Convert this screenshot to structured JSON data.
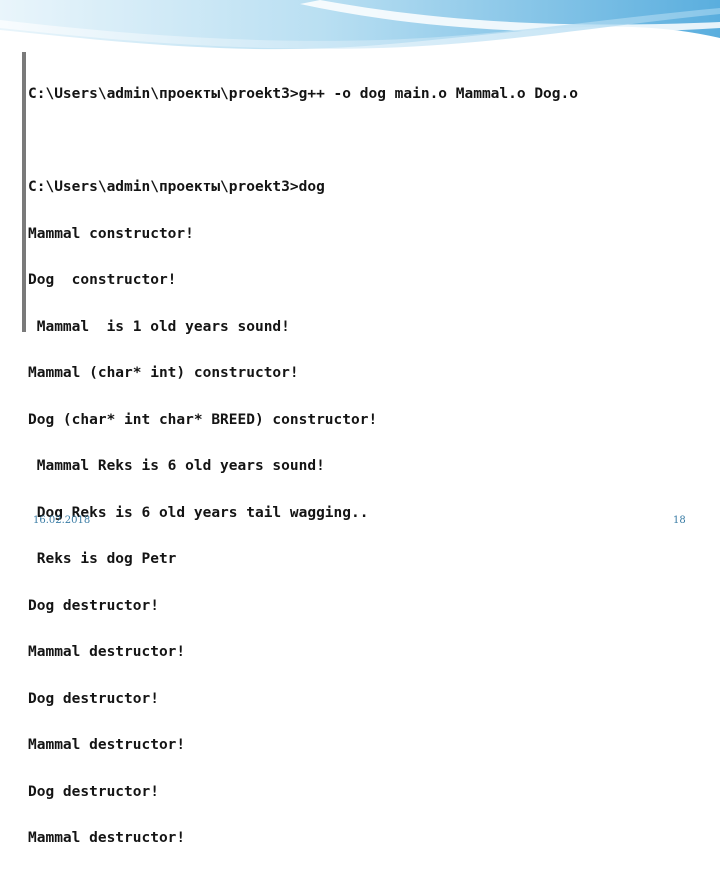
{
  "console": {
    "lines": [
      "C:\\Users\\admin\\проекты\\proekt3>g++ -o dog main.o Mammal.o Dog.o",
      "",
      "C:\\Users\\admin\\проекты\\proekt3>dog",
      "Mammal constructor!",
      "Dog  constructor!",
      " Mammal  is 1 old years sound!",
      "Mammal (char* int) constructor!",
      "Dog (char* int char* BREED) constructor!",
      " Mammal Reks is 6 old years sound!",
      " Dog Reks is 6 old years tail wagging..",
      " Reks is dog Petr",
      "Dog destructor!",
      "Mammal destructor!",
      "Dog destructor!",
      "Mammal destructor!",
      "Dog destructor!",
      "Mammal destructor!"
    ]
  },
  "footer": {
    "date": "16.02.2018",
    "page_number": "18"
  },
  "colors": {
    "accent": "#3a7ca5",
    "wave_light": "#d8ecf7",
    "wave_mid": "#8fc6e6",
    "wave_dark": "#4a9fd4"
  }
}
